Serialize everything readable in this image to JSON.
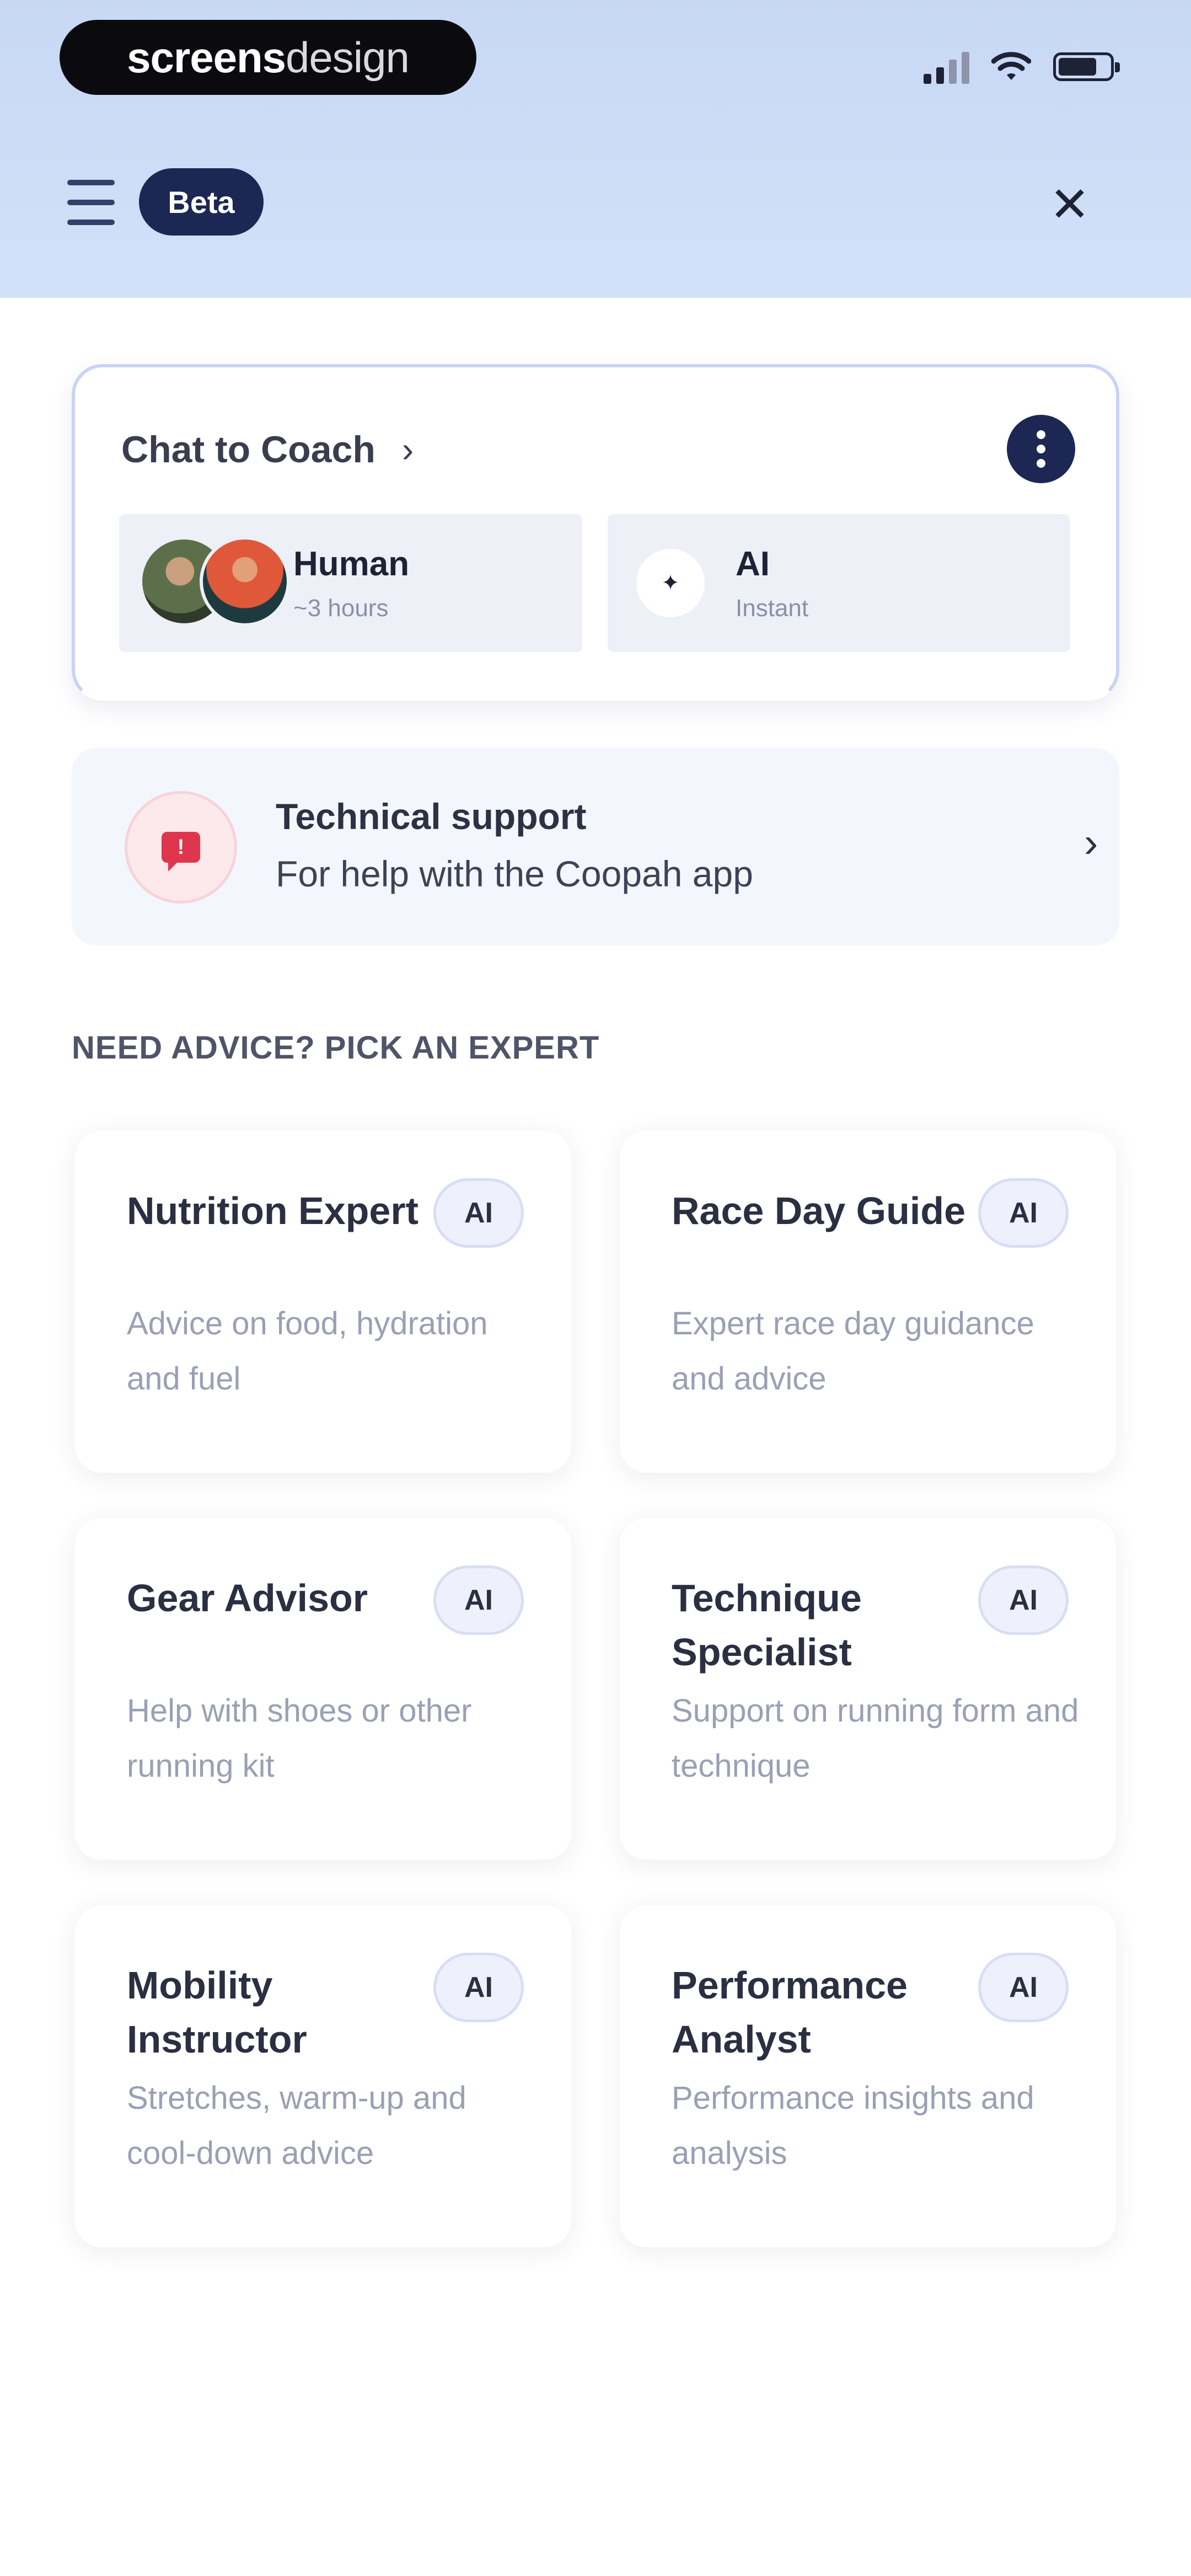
{
  "status_bar": {
    "brand_bold": "screens",
    "brand_light": "design",
    "icons": [
      "signal-icon",
      "wifi-icon",
      "battery-icon"
    ]
  },
  "nav": {
    "beta_label": "Beta",
    "close_glyph": "✕"
  },
  "coach": {
    "title": "Chat to Coach",
    "chevron": "›",
    "options": [
      {
        "title": "Human",
        "subtitle": "~3 hours"
      },
      {
        "title": "AI",
        "subtitle": "Instant",
        "glyph": "✦"
      }
    ]
  },
  "support": {
    "title": "Technical support",
    "subtitle": "For help with the Coopah app",
    "icon_glyph": "!",
    "chevron": "›"
  },
  "experts": {
    "section_title": "NEED ADVICE? PICK AN EXPERT",
    "badge": "AI",
    "items": [
      {
        "title": "Nutrition Expert",
        "description": "Advice on food, hydration and fuel"
      },
      {
        "title": "Race Day Guide",
        "description": "Expert race day guidance and advice"
      },
      {
        "title": "Gear Advisor",
        "description": "Help with shoes or other running kit"
      },
      {
        "title": "Technique Specialist",
        "description": "Support on running form and technique"
      },
      {
        "title": "Mobility Instructor",
        "description": "Stretches, warm-up and cool-down advice"
      },
      {
        "title": "Performance Analyst",
        "description": "Performance insights and analysis"
      }
    ]
  },
  "colors": {
    "header_gradient": "#c7d8f5",
    "navy": "#1c2754",
    "support_red": "#e0364d"
  }
}
